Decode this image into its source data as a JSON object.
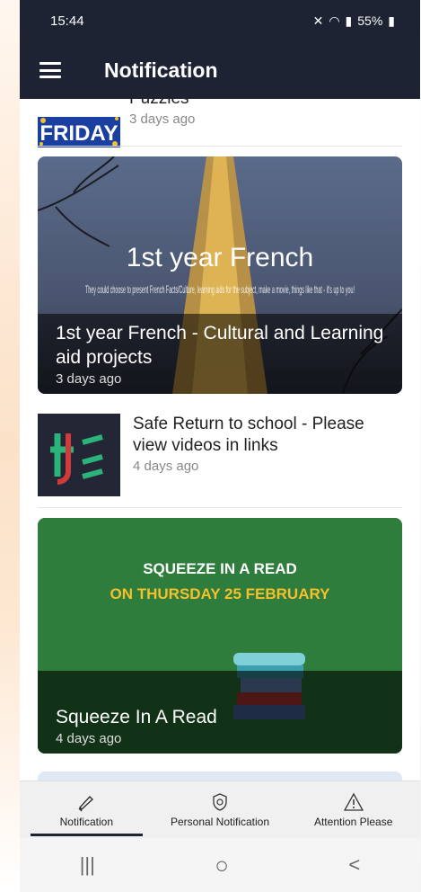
{
  "status": {
    "time": "15:44",
    "battery": "55%"
  },
  "appbar": {
    "title": "Notification"
  },
  "feed": [
    {
      "title": "Puzzles",
      "time": "3 days ago",
      "thumb_text": "FRIDAY"
    },
    {
      "title": "1st year French - Cultural and Learning aid projects",
      "time": "3 days ago",
      "image_title": "1st year French",
      "image_sub": "They could choose to present French Facts/Culture, learning aids for the subject, make a movie, things like that - it's up to you!"
    },
    {
      "title": "Safe Return to school - Please view videos in links",
      "time": "4 days ago"
    },
    {
      "title": "Squeeze In A Read",
      "time": "4 days ago",
      "image_line1": "SQUEEZE IN A READ",
      "image_line2": "ON THURSDAY 25 FEBRUARY"
    }
  ],
  "bottomnav": [
    {
      "label": "Notification",
      "icon": "megaphone-icon",
      "active": true
    },
    {
      "label": "Personal Notification",
      "icon": "shield-icon",
      "active": false
    },
    {
      "label": "Attention Please",
      "icon": "warning-icon",
      "active": false
    }
  ],
  "sysnav": {
    "recents": "|||",
    "home": "○",
    "back": "<"
  },
  "colors": {
    "appbar": "#1e2333",
    "green_card": "#2e7d3c",
    "headline_yellow": "#f6c02c"
  }
}
